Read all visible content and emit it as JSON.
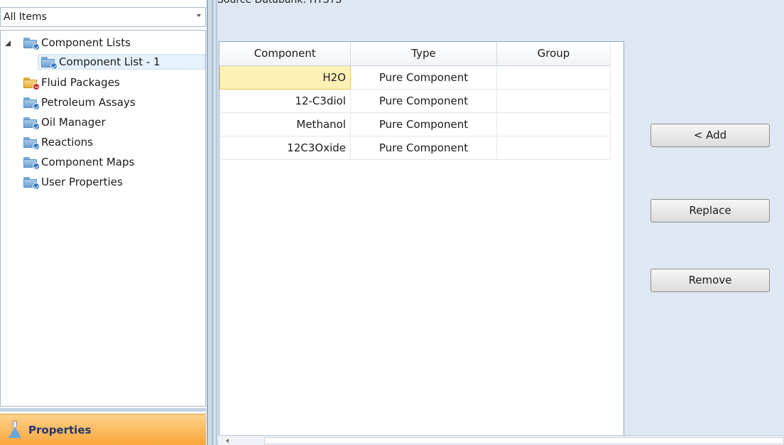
{
  "navigator": {
    "filter_value": "All Items",
    "tree": [
      {
        "label": "Component Lists",
        "icon": "folder-check-icon",
        "expanded": true
      },
      {
        "label": "Component List - 1",
        "icon": "folder-check-icon",
        "selected": true
      },
      {
        "label": "Fluid Packages",
        "icon": "folder-warning-icon"
      },
      {
        "label": "Petroleum Assays",
        "icon": "folder-check-icon"
      },
      {
        "label": "Oil Manager",
        "icon": "folder-check-icon"
      },
      {
        "label": "Reactions",
        "icon": "folder-check-icon"
      },
      {
        "label": "Component Maps",
        "icon": "folder-check-icon"
      },
      {
        "label": "User Properties",
        "icon": "folder-check-icon"
      }
    ],
    "properties_label": "Properties"
  },
  "main": {
    "source_databank": "Source Databank: HYSYS",
    "columns": [
      "Component",
      "Type",
      "Group"
    ],
    "rows": [
      {
        "component": "H2O",
        "type": "Pure Component",
        "group": ""
      },
      {
        "component": "12-C3diol",
        "type": "Pure Component",
        "group": ""
      },
      {
        "component": "Methanol",
        "type": "Pure Component",
        "group": ""
      },
      {
        "component": "12C3Oxide",
        "type": "Pure Component",
        "group": ""
      }
    ],
    "buttons": {
      "add": "< Add",
      "replace": "Replace",
      "remove": "Remove"
    }
  },
  "colors": {
    "accent_orange": "#f7a63c",
    "selection_yellow": "#fff0b5",
    "panel_blue": "#dfe8f2"
  }
}
